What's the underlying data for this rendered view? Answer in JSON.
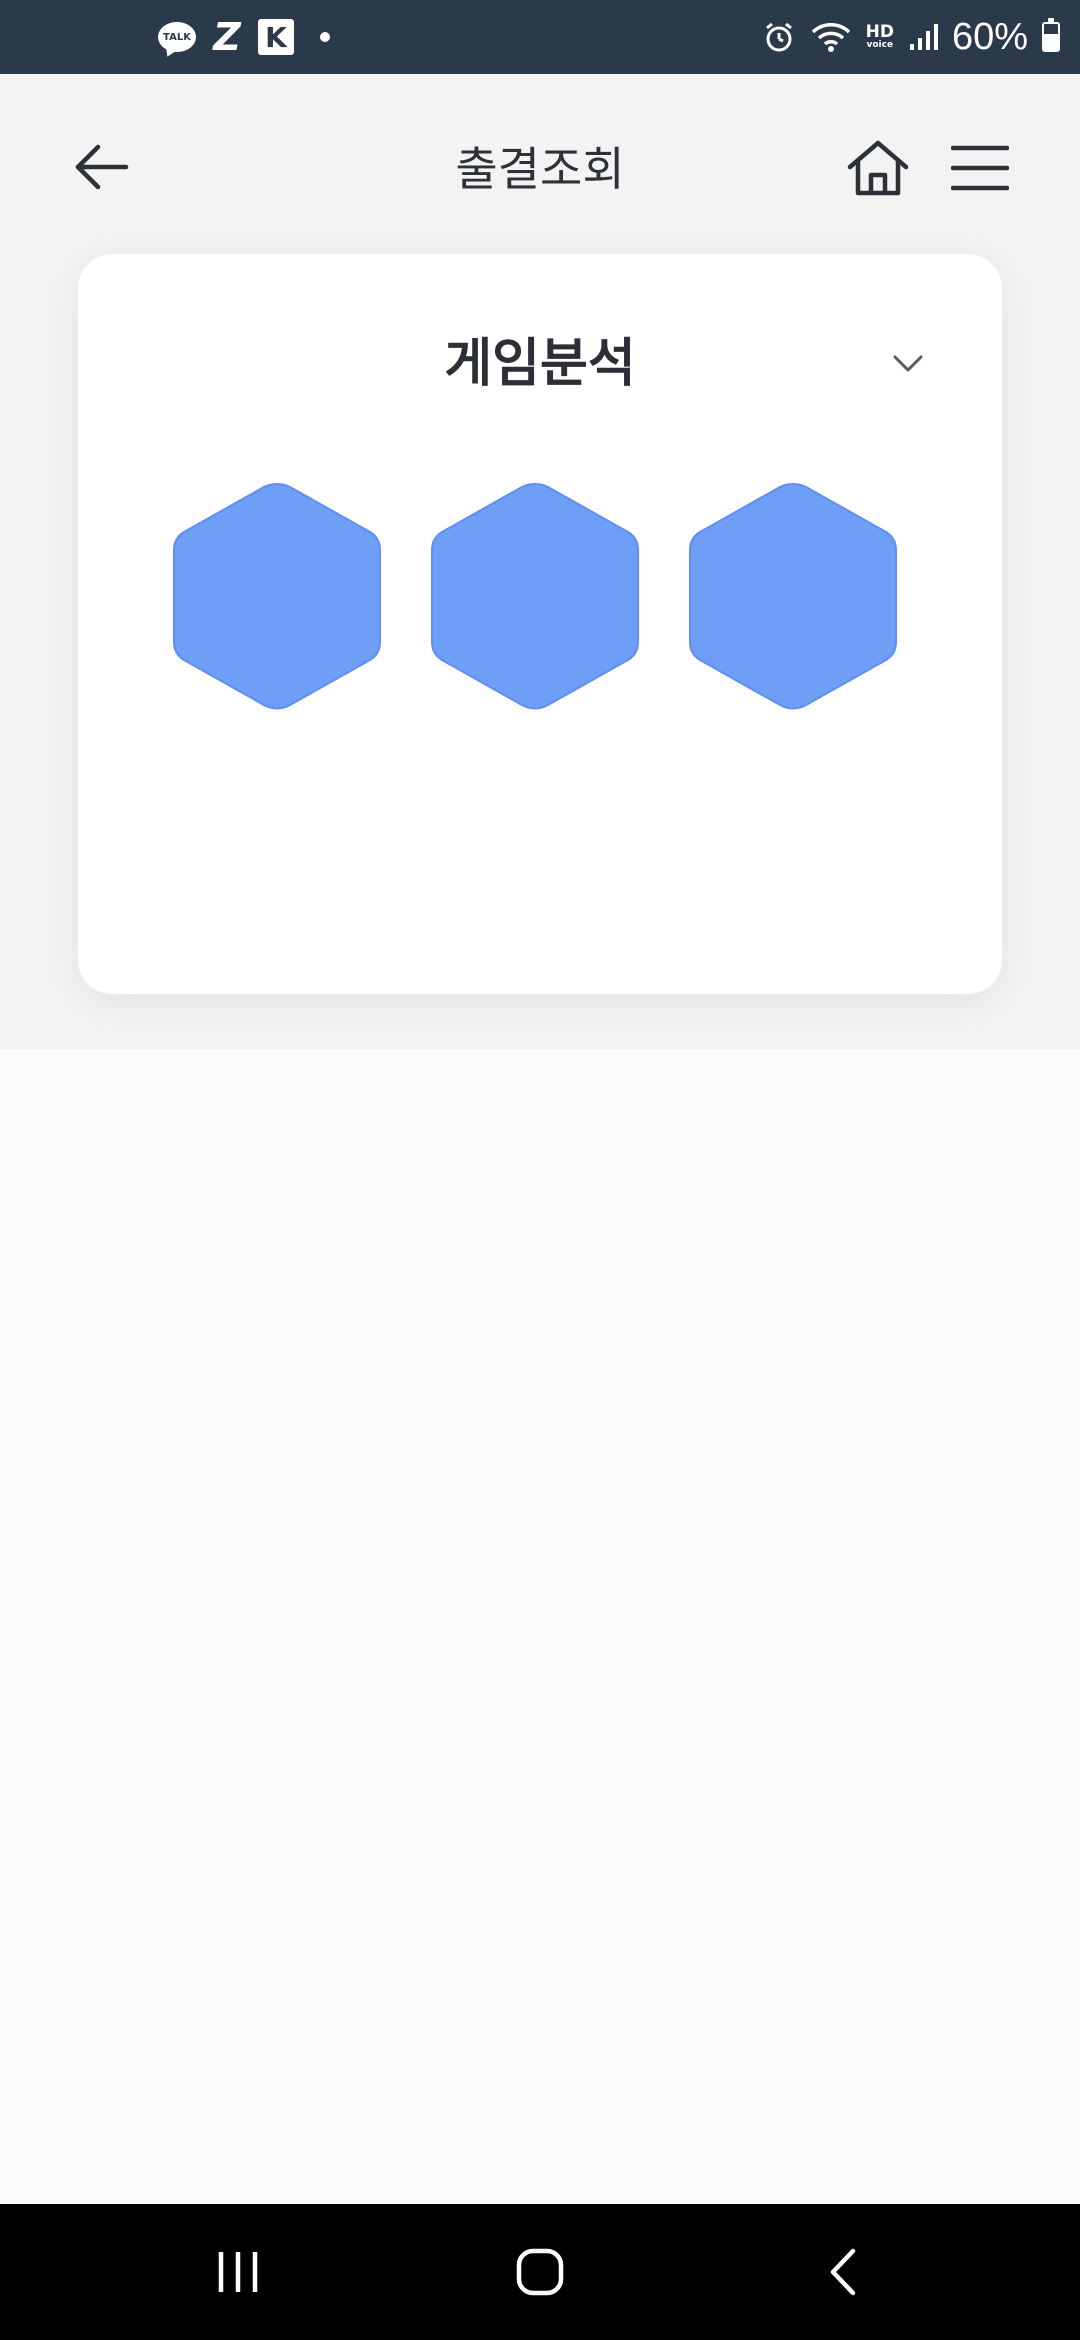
{
  "status_bar": {
    "left_icons": [
      "kakaotalk-icon",
      "z-app-icon",
      "k-app-icon",
      "notification-dot-icon"
    ],
    "talk_label": "TALK",
    "z_label": "Z",
    "k_label": "K",
    "hd_label": "HD",
    "voice_label": "voice",
    "battery_percent": 60,
    "battery_text": "60%"
  },
  "header": {
    "title": "출결조회",
    "back_icon": "arrow-left-icon",
    "home_icon": "home-icon",
    "menu_icon": "hamburger-menu-icon"
  },
  "card": {
    "title": "게임분석",
    "dropdown_icon": "chevron-down-icon",
    "hexagons": [
      {
        "icon": "hexagon-icon",
        "color": "#6f9ef7"
      },
      {
        "icon": "hexagon-icon",
        "color": "#6f9ef7"
      },
      {
        "icon": "hexagon-icon",
        "color": "#6f9ef7"
      }
    ]
  },
  "colors": {
    "status_bar_bg": "#2b3a4b",
    "hexagon_fill": "#6f9ef7",
    "hexagon_stroke": "#5f8ff0",
    "title_text": "#2c2f36",
    "nav_bar_bg": "#000000"
  },
  "nav_bar": {
    "items": [
      "recent-apps-icon",
      "home-circle-icon",
      "back-chevron-icon"
    ]
  }
}
